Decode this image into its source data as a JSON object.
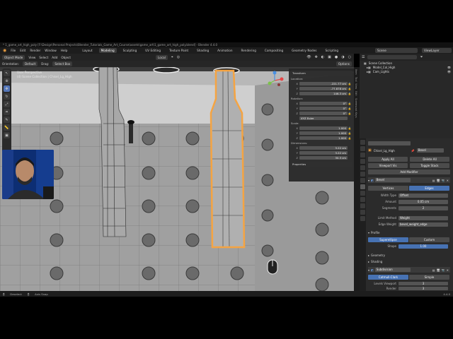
{
  "window": {
    "title": "* 1_game_art_high_poly [F:\\Design\\Personal Projects\\Blender_Tutorials_Game_Art_Course\\assets\\game_art\\1_game_art_high_poly.blend] - Blender 4.4.0"
  },
  "menubar": {
    "menus": [
      "File",
      "Edit",
      "Render",
      "Window",
      "Help"
    ],
    "workspaces": [
      "Layout",
      "Modeling",
      "Sculpting",
      "UV Editing",
      "Texture Paint",
      "Shading",
      "Animation",
      "Rendering",
      "Compositing",
      "Geometry Nodes",
      "Scripting"
    ],
    "active_workspace": "Modeling",
    "scene": "Scene",
    "view_layer": "ViewLayer"
  },
  "header3d": {
    "mode": "Object Mode",
    "menus": [
      "View",
      "Select",
      "Add",
      "Object"
    ],
    "transform": "Local",
    "options": "Options"
  },
  "optbar": {
    "orientation_label": "Orientation:",
    "orientation": "Default",
    "drag_label": "Drag:",
    "drag": "Select Box"
  },
  "viewport": {
    "perspective": "User Perspective",
    "collection": "(4) Scene Collection | Chisel_Lg_High"
  },
  "npanel": {
    "title": "Transform",
    "location_label": "Location:",
    "location": [
      {
        "axis": "X",
        "value": "-221.77 cm"
      },
      {
        "axis": "Y",
        "value": "-77.878 cm"
      },
      {
        "axis": "Z",
        "value": "146.3 cm"
      }
    ],
    "rotation_label": "Rotation:",
    "rotation": [
      {
        "axis": "X",
        "value": "0°"
      },
      {
        "axis": "Y",
        "value": "0°"
      },
      {
        "axis": "Z",
        "value": "0°"
      }
    ],
    "rotation_mode": "XYZ Euler",
    "scale_label": "Scale:",
    "scale": [
      {
        "axis": "X",
        "value": "1.000"
      },
      {
        "axis": "Y",
        "value": "1.000"
      },
      {
        "axis": "Z",
        "value": "1.000"
      }
    ],
    "dimensions_label": "Dimensions:",
    "dimensions": [
      {
        "axis": "X",
        "value": "3.22 cm"
      },
      {
        "axis": "Y",
        "value": "3.22 cm"
      },
      {
        "axis": "Z",
        "value": "30.3 cm"
      }
    ],
    "properties_label": "Properties"
  },
  "sidetabs": [
    "Item",
    "Tool",
    "View",
    "Edit",
    "Screencast Keys"
  ],
  "outliner": {
    "title": "Scene Collection",
    "items": [
      "Model_Col_High",
      "Cam_Lights"
    ]
  },
  "properties": {
    "object_name": "Chisel_Lg_High",
    "modifier_dropdown": "Bevel",
    "apply_all": "Apply All",
    "delete_all": "Delete All",
    "viewport_vis": "Viewport Vis",
    "toggle_stack": "Toggle Stack",
    "add_modifier": "Add Modifier",
    "bevel": {
      "name": "Bevel",
      "vertices": "Vertices",
      "edges": "Edges",
      "width_type_label": "Width Type",
      "width_type": "Offset",
      "amount_label": "Amount",
      "amount": "0.05 cm",
      "segments_label": "Segments",
      "segments": "2",
      "limit_method_label": "Limit Method",
      "limit_method": "Weight",
      "edge_weight_label": "Edge Weight",
      "edge_weight": "bevel_weight_edge",
      "profile": "Profile",
      "superellipse": "Superellipse",
      "custom": "Custom",
      "shape_label": "Shape",
      "shape": "1.00",
      "geometry": "Geometry",
      "shading": "Shading"
    },
    "subdivision": {
      "name": "Subdivision",
      "catmull": "Catmull-Clark",
      "simple": "Simple",
      "levels_label": "Levels Viewport",
      "levels": "3",
      "render_label": "Render",
      "render": "3"
    }
  },
  "statusbar": {
    "items": [
      "Deselect",
      "Axis Snap"
    ],
    "version": "4.4.0"
  },
  "colors": {
    "accent": "#4772b3",
    "selection": "#f5a442",
    "viewport_bg": "#8e8e8e"
  }
}
